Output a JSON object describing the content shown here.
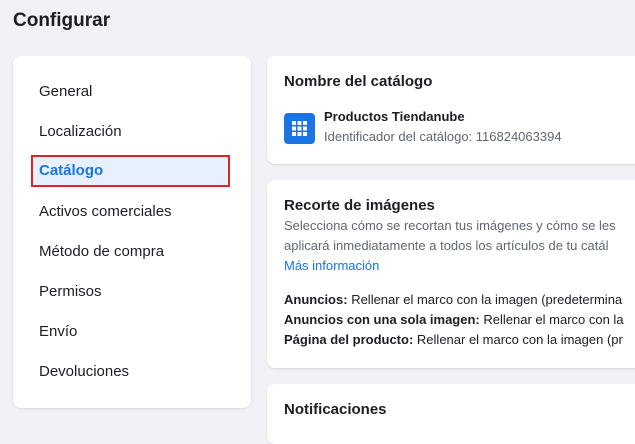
{
  "page": {
    "title": "Configurar"
  },
  "sidebar": {
    "items": [
      {
        "label": "General"
      },
      {
        "label": "Localización"
      },
      {
        "label": "Catálogo"
      },
      {
        "label": "Activos comerciales"
      },
      {
        "label": "Método de compra"
      },
      {
        "label": "Permisos"
      },
      {
        "label": "Envío"
      },
      {
        "label": "Devoluciones"
      }
    ],
    "active_index": 2
  },
  "catalog_name_card": {
    "title": "Nombre del catálogo",
    "icon": "grid-icon",
    "name": "Productos Tiendanube",
    "id_text": "Identificador del catálogo: 116824063394"
  },
  "image_crop_card": {
    "title": "Recorte de imágenes",
    "description_line1": "Selecciona cómo se recortan tus imágenes y cómo se les",
    "description_line2": "aplicará inmediatamente a todos los artículos de tu catál",
    "link": "Más información",
    "rows": [
      {
        "label": "Anuncios:",
        "value": "Rellenar el marco con la imagen (predetermina"
      },
      {
        "label": "Anuncios con una sola imagen:",
        "value": "Rellenar el marco con la"
      },
      {
        "label": "Página del producto:",
        "value": "Rellenar el marco con la imagen (pr"
      }
    ]
  },
  "notifications_card": {
    "title": "Notificaciones"
  },
  "colors": {
    "accent": "#1b74e4",
    "highlight_border": "#e02424",
    "active_bg": "#e7f0fd"
  }
}
